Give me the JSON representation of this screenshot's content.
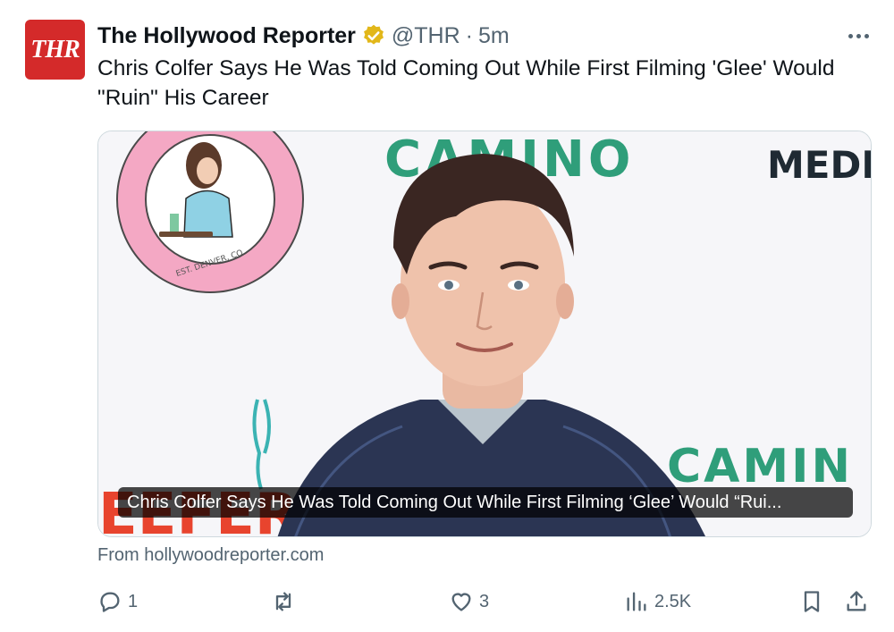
{
  "tweet": {
    "avatar_text": "THR",
    "display_name": "The Hollywood Reporter",
    "handle": "@THR",
    "separator": "·",
    "time": "5m",
    "text_line1": "Chris Colfer Says He Was Told Coming Out While First Filming 'Glee' Would",
    "text_line2": "\"Ruin\" His Career"
  },
  "card": {
    "caption": "Chris Colfer Says He Was Told Coming Out While First Filming ‘Glee’ Would “Rui...",
    "source": "From hollywoodreporter.com",
    "backdrop_texts": {
      "camino_top": "CAMINO",
      "media": "MEDIA",
      "camino_bottom": "CAMIN",
      "logo_text": "EST. DENVER, CO",
      "eefer": "EEFER"
    }
  },
  "actions": {
    "replies": "1",
    "reposts": "",
    "likes": "3",
    "views": "2.5K"
  },
  "icons": {
    "verified": "verified-badge-icon",
    "more": "more-icon",
    "reply": "reply-icon",
    "repost": "repost-icon",
    "like": "like-icon",
    "views": "views-icon",
    "bookmark": "bookmark-icon",
    "share": "share-icon"
  },
  "colors": {
    "thr_red": "#d42a2a",
    "verified_gold": "#e2b719",
    "secondary_text": "#536471",
    "camino_green": "#2f9e7a",
    "logo_pink": "#f4a8c4"
  }
}
